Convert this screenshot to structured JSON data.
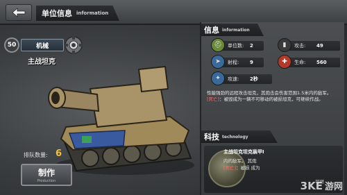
{
  "header": {
    "title_cn": "单位信息",
    "title_en": "information"
  },
  "unit": {
    "level": "50",
    "type": "机械",
    "name": "主战坦克",
    "queue_label": "排队数量:",
    "queue_value": "6",
    "build_label": "制作",
    "build_sub": "Production"
  },
  "info": {
    "title_cn": "信息",
    "title_en": "information",
    "stats": [
      {
        "name": "单位数:",
        "value": "2",
        "icon": "helmet-icon",
        "color": "#6a8a3a"
      },
      {
        "name": "攻击:",
        "value": "49",
        "icon": "bullets-icon",
        "color": "#3a3a3a"
      },
      {
        "name": "射程:",
        "value": "9",
        "icon": "range-icon",
        "color": "#3a6a9a"
      },
      {
        "name": "生命:",
        "value": "560",
        "icon": "health-icon",
        "color": "#b23a2a"
      },
      {
        "name": "攻速:",
        "value": "2秒",
        "icon": "speed-icon",
        "color": "#3a6a9a"
      }
    ],
    "desc_main": "性能强劲的远程攻击坦克，其炮击会伤害范围1.5米内的敌军。",
    "desc_tag": "[死亡]",
    "desc_tag_text": "：被毁成为一辆不可移动的被损坦克，可继续作战。"
  },
  "tech": {
    "title_cn": "科技",
    "title_en": "technology",
    "item_title": "主战坦克坦克装甲I",
    "line1": "内的敌军。   其炮",
    "line2_tag": "[死亡]",
    "line2": "：被损   成为",
    "extra": "可继"
  },
  "watermark": {
    "logo": "3KE",
    "text": "游网"
  }
}
